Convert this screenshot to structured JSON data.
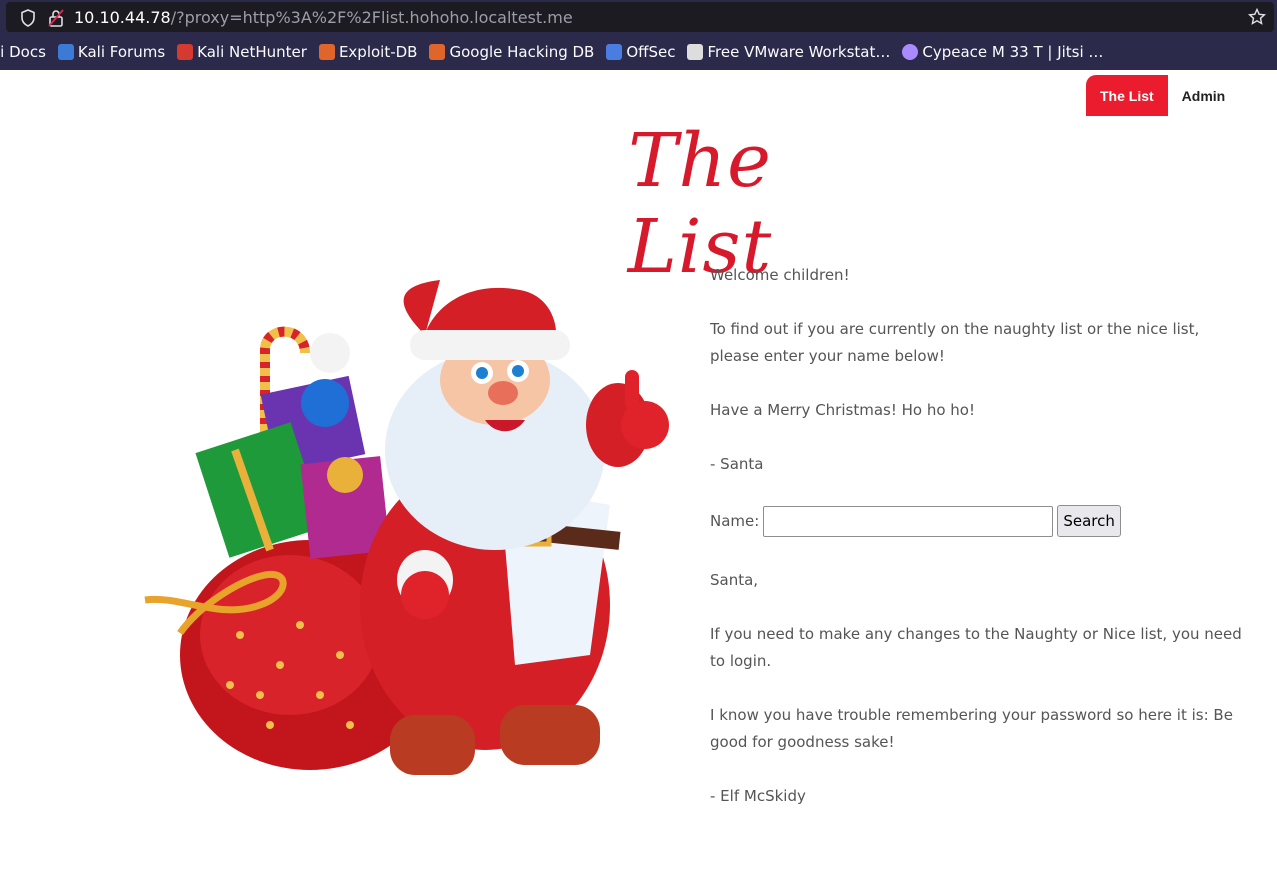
{
  "browser": {
    "url_host": "10.10.44.78",
    "url_path": "/?proxy=http%3A%2F%2Flist.hohoho.localtest.me",
    "bookmarks": [
      {
        "label": "li Docs",
        "icon": "kali-docs-icon",
        "color": "#3b7bd6"
      },
      {
        "label": "Kali Forums",
        "icon": "kali-forums-icon",
        "color": "#3b7bd6"
      },
      {
        "label": "Kali NetHunter",
        "icon": "kali-nethunter-icon",
        "color": "#d43a2f"
      },
      {
        "label": "Exploit-DB",
        "icon": "exploit-db-icon",
        "color": "#e0652b"
      },
      {
        "label": "Google Hacking DB",
        "icon": "ghdb-icon",
        "color": "#e0652b"
      },
      {
        "label": "OffSec",
        "icon": "offsec-icon",
        "color": "#4a7de0"
      },
      {
        "label": "Free VMware Workstat…",
        "icon": "github-icon",
        "color": "#dddddd"
      },
      {
        "label": "Cypeace M 33 T | Jitsi …",
        "icon": "globe-icon",
        "color": "#a98bff"
      }
    ]
  },
  "nav": {
    "the_list": "The List",
    "admin": "Admin",
    "active_color": "#ea1c2e"
  },
  "title": "The List",
  "intro": {
    "greeting": "Welcome children!",
    "instructions": "To find out if you are currently on the naughty list or the nice list, please enter your name below!",
    "wish": "Have a Merry Christmas! Ho ho ho!",
    "signature": "- Santa"
  },
  "search": {
    "label": "Name:",
    "value": "",
    "button": "Search"
  },
  "note": {
    "salutation": "Santa,",
    "body": "If you need to make any changes to the Naughty or Nice list, you need to login.",
    "password_hint": "I know you have trouble remembering your password so here it is: Be good for goodness sake!",
    "signature": "- Elf McSkidy"
  }
}
